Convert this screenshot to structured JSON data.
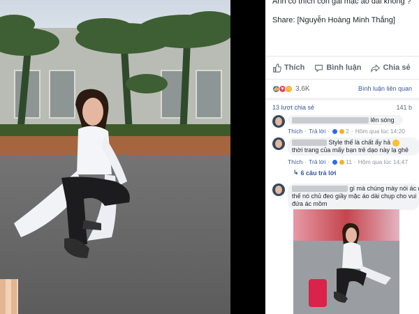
{
  "post": {
    "question": "Anh có thích con gái mặc áo dài không ?",
    "share_credit": "Share: [Nguyễn Hoàng Minh Thắng]"
  },
  "actions": {
    "like": "Thích",
    "comment": "Bình luận",
    "share": "Chia sẻ"
  },
  "reactions": {
    "count": "3,6K",
    "related_comments": "Bình luận liên quan"
  },
  "shares": {
    "count_label": "13 lượt chia sẻ",
    "right_count": "141 b"
  },
  "comments": [
    {
      "text_tail": "lên sóng",
      "like": "Thích",
      "reply": "Trả lời",
      "reaction_count": "2",
      "time": "Hôm qua lúc 14:20"
    },
    {
      "line1": "Style thế là chất ấy hả",
      "line2": "thời trang của mấy bạn trẻ dạo này lạ ghê",
      "like": "Thích",
      "reply": "Trả lời",
      "reaction_count": "11",
      "time": "Hôm qua lúc 14:47",
      "replies_label": "6 câu trả lời"
    },
    {
      "line1": "gì mà chúng mày nói ác m",
      "line2": "thế nó chủ đeo giầy mặc áo dài chụp cho vui",
      "line3": "đứa ác mồm"
    }
  ],
  "colors": {
    "facebook_blue": "#385898",
    "like_blue": "#2c6bed",
    "love_red": "#f33e58",
    "haha_yellow": "#f7b125"
  }
}
